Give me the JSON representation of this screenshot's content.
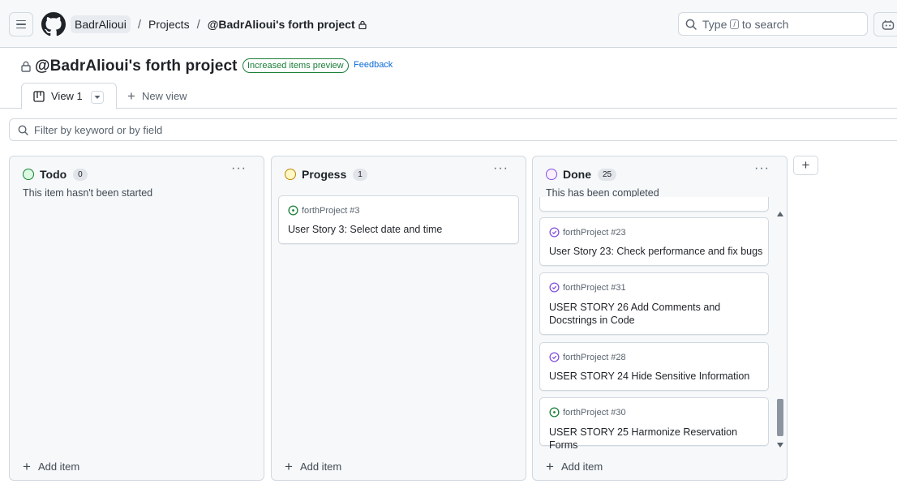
{
  "header": {
    "owner": "BadrAlioui",
    "projects_link": "Projects",
    "current": "@BadrAlioui's forth project",
    "separator": "/",
    "search_prefix": "Type",
    "search_key": "/",
    "search_suffix": "to search"
  },
  "project": {
    "title": "@BadrAlioui's forth project",
    "preview_badge": "Increased items preview",
    "feedback": "Feedback"
  },
  "tabs": {
    "view_label": "View 1",
    "new_view": "New view"
  },
  "filter": {
    "placeholder": "Filter by keyword or by field"
  },
  "columns": [
    {
      "name": "Todo",
      "count": "0",
      "description": "This item hasn't been started",
      "status_color": "#1a7f37",
      "add_label": "Add item",
      "cards": []
    },
    {
      "name": "Progess",
      "count": "1",
      "description": "",
      "status_color": "#bf8700",
      "add_label": "Add item",
      "cards": [
        {
          "meta": "forthProject #3",
          "title": "User Story 3: Select date and time",
          "icon": "issue-open-icon"
        }
      ]
    },
    {
      "name": "Done",
      "count": "25",
      "description": "This has been completed",
      "status_color": "#8250df",
      "add_label": "Add item",
      "cards": [
        {
          "meta": "forthProject #23",
          "title": "User Story 23: Check performance and fix bugs",
          "icon": "issue-closed-icon"
        },
        {
          "meta": "forthProject #31",
          "title": "USER STORY 26 Add Comments and Docstrings in Code",
          "icon": "issue-closed-icon"
        },
        {
          "meta": "forthProject #28",
          "title": "USER STORY 24 Hide Sensitive Information",
          "icon": "issue-closed-icon"
        },
        {
          "meta": "forthProject #30",
          "title": "USER STORY 25 Harmonize Reservation Forms",
          "icon": "issue-open-icon"
        }
      ]
    }
  ],
  "colors": {
    "open_issue": "#1a7f37",
    "closed_issue": "#8250df",
    "link": "#0969da"
  }
}
